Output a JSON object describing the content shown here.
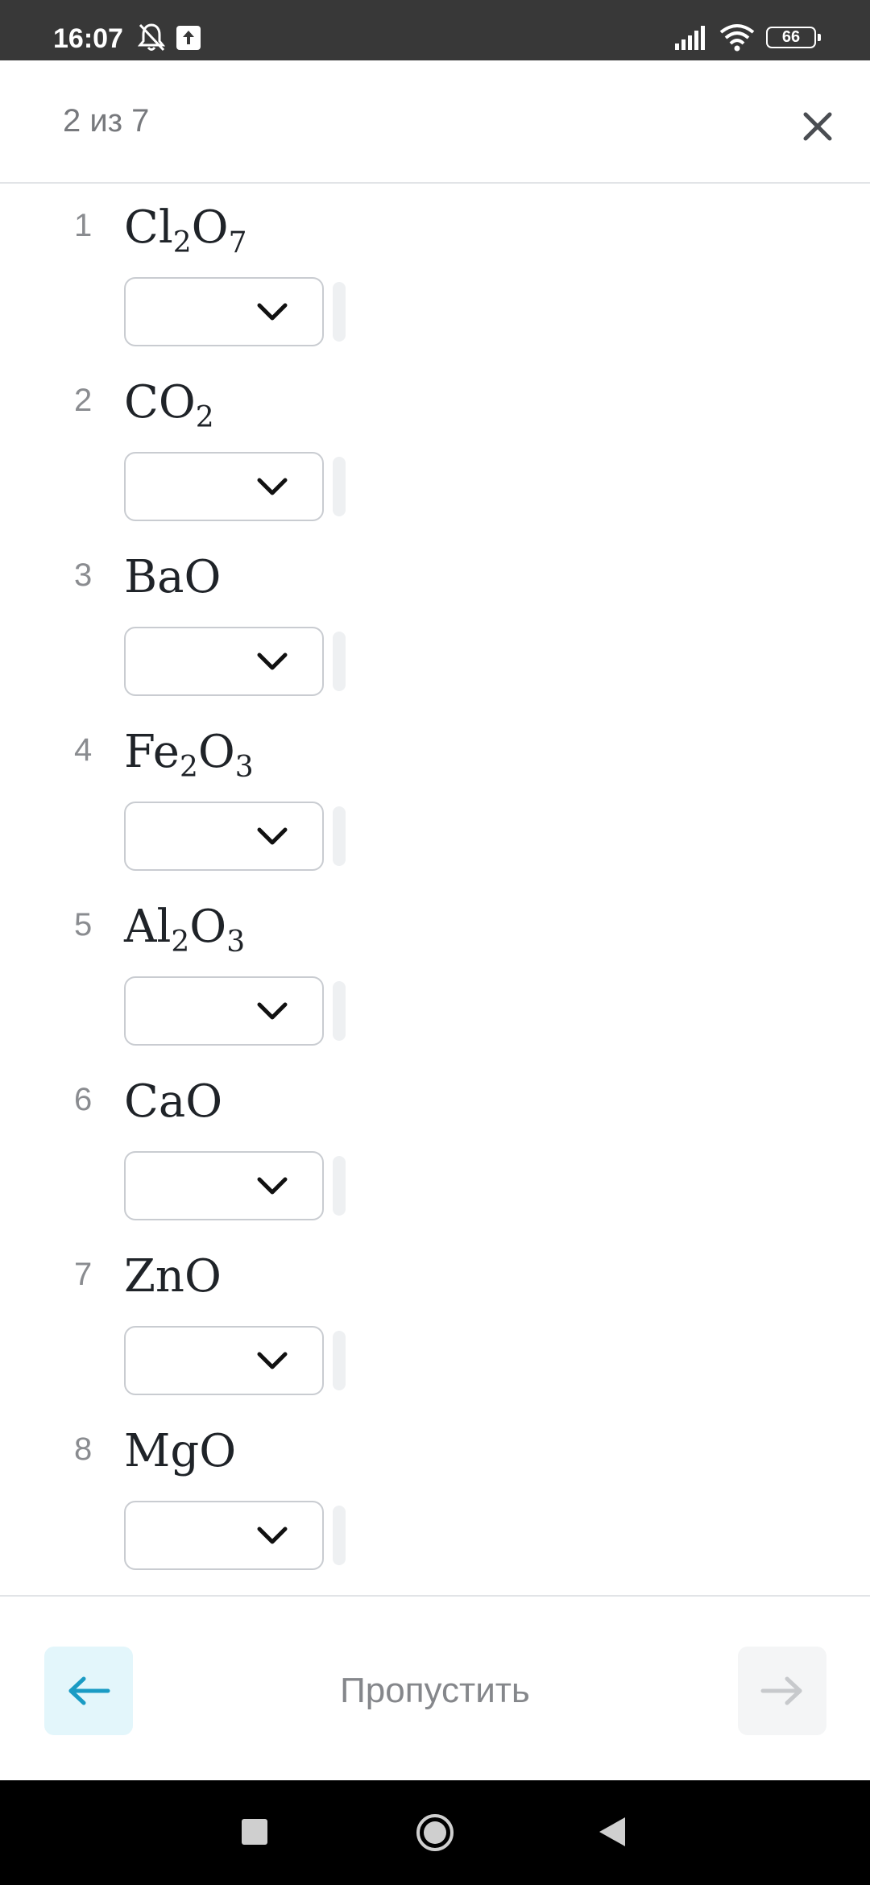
{
  "status_bar": {
    "time": "16:07",
    "battery": "66",
    "icons": [
      "bell-off-icon",
      "upload-icon",
      "signal-icon",
      "wifi-icon",
      "battery-icon"
    ]
  },
  "header": {
    "progress": "2 из 7",
    "close_icon": "close-icon"
  },
  "questions": [
    {
      "number": "1",
      "formula": [
        {
          "t": "Cl"
        },
        {
          "s": "2"
        },
        {
          "t": "O"
        },
        {
          "s": "7"
        }
      ],
      "selected": ""
    },
    {
      "number": "2",
      "formula": [
        {
          "t": "CO"
        },
        {
          "s": "2"
        }
      ],
      "selected": ""
    },
    {
      "number": "3",
      "formula": [
        {
          "t": "BaO"
        }
      ],
      "selected": ""
    },
    {
      "number": "4",
      "formula": [
        {
          "t": "Fe"
        },
        {
          "s": "2"
        },
        {
          "t": "O"
        },
        {
          "s": "3"
        }
      ],
      "selected": ""
    },
    {
      "number": "5",
      "formula": [
        {
          "t": "Al"
        },
        {
          "s": "2"
        },
        {
          "t": "O"
        },
        {
          "s": "3"
        }
      ],
      "selected": ""
    },
    {
      "number": "6",
      "formula": [
        {
          "t": "CaO"
        }
      ],
      "selected": ""
    },
    {
      "number": "7",
      "formula": [
        {
          "t": "ZnO"
        }
      ],
      "selected": ""
    },
    {
      "number": "8",
      "formula": [
        {
          "t": "MgO"
        }
      ],
      "selected": ""
    }
  ],
  "footer": {
    "skip_label": "Пропустить",
    "back_icon": "arrow-left-icon",
    "next_icon": "arrow-right-icon",
    "back_color": "#1a9bc4",
    "next_color": "#c7c9cc"
  },
  "colors": {
    "status_bar": "#383838",
    "accent_bg": "#e3f6fb",
    "border": "#c9ccd1"
  }
}
